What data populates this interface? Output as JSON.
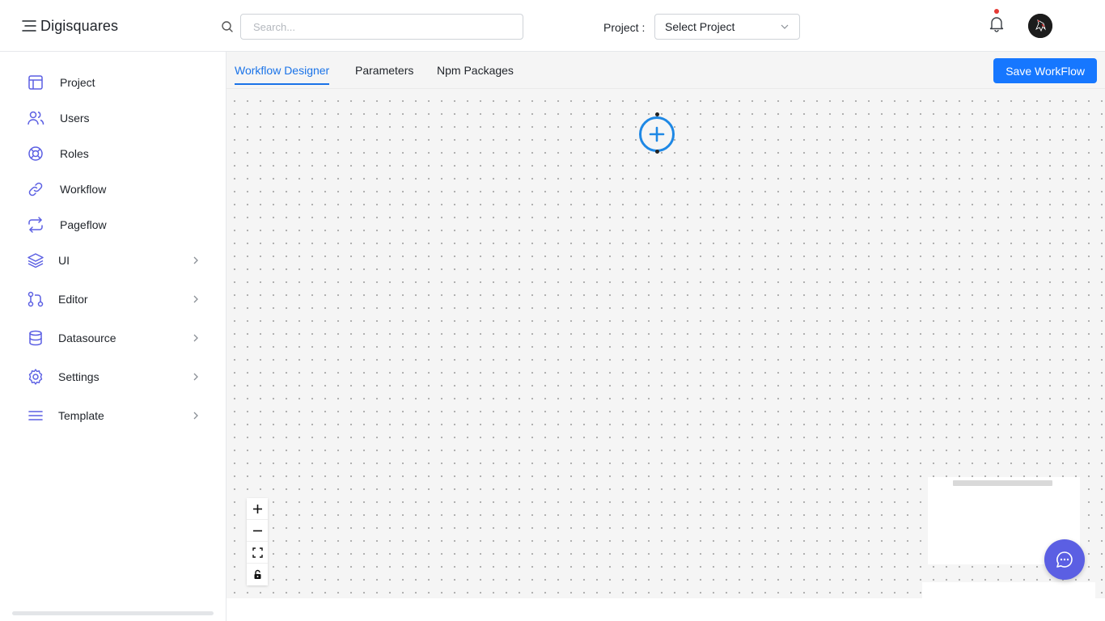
{
  "header": {
    "brand_name": "Digisquares",
    "search_placeholder": "Search...",
    "project_label": "Project :",
    "project_select_value": "Select Project"
  },
  "sidebar": {
    "items": [
      {
        "label": "Project",
        "icon": "table-icon",
        "has_submenu": false
      },
      {
        "label": "Users",
        "icon": "users-icon",
        "has_submenu": false
      },
      {
        "label": "Roles",
        "icon": "lifebuoy-icon",
        "has_submenu": false
      },
      {
        "label": "Workflow",
        "icon": "link-icon",
        "has_submenu": false
      },
      {
        "label": "Pageflow",
        "icon": "repeat-icon",
        "has_submenu": false
      },
      {
        "label": "UI",
        "icon": "layers-icon",
        "has_submenu": true
      },
      {
        "label": "Editor",
        "icon": "git-pull-request-icon",
        "has_submenu": true
      },
      {
        "label": "Datasource",
        "icon": "database-icon",
        "has_submenu": true
      },
      {
        "label": "Settings",
        "icon": "gear-icon",
        "has_submenu": true
      },
      {
        "label": "Template",
        "icon": "menu-lines-icon",
        "has_submenu": true
      }
    ]
  },
  "main": {
    "tabs": [
      {
        "label": "Workflow Designer",
        "active": true
      },
      {
        "label": "Parameters",
        "active": false
      },
      {
        "label": "Npm Packages",
        "active": false
      }
    ],
    "save_button_label": "Save WorkFlow"
  },
  "colors": {
    "accent": "#1677ff",
    "icon": "#5b5fe3",
    "node_border": "#1e88e5",
    "notification_dot": "#e53935"
  }
}
